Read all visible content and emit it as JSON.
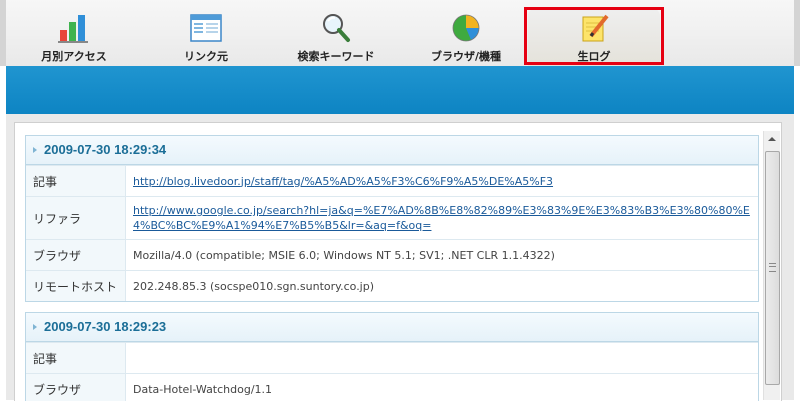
{
  "tabs": [
    {
      "label": "月別アクセス",
      "icon": "bar-chart-icon"
    },
    {
      "label": "リンク元",
      "icon": "window-list-icon"
    },
    {
      "label": "検索キーワード",
      "icon": "magnifier-icon"
    },
    {
      "label": "ブラウザ/機種",
      "icon": "pie-chart-icon"
    },
    {
      "label": "生ログ",
      "icon": "notepad-pencil-icon",
      "active": true
    }
  ],
  "colors": {
    "accent_blue": "#1490cc",
    "highlight_red": "#e60012",
    "heading_blue": "#1b6e97"
  },
  "entries": [
    {
      "timestamp": "2009-07-30 18:29:34",
      "rows": [
        {
          "label": "記事",
          "value": "http://blog.livedoor.jp/staff/tag/%A5%AD%A5%F3%C6%F9%A5%DE%A5%F3",
          "link": true
        },
        {
          "label": "リファラ",
          "value": "http://www.google.co.jp/search?hl=ja&q=%E7%AD%8B%E8%82%89%E3%83%9E%E3%83%B3%E3%80%80%E4%BC%BC%E9%A1%94%E7%B5%B5&lr=&aq=f&oq=",
          "link": true
        },
        {
          "label": "ブラウザ",
          "value": "Mozilla/4.0 (compatible; MSIE 6.0; Windows NT 5.1; SV1; .NET CLR 1.1.4322)",
          "link": false
        },
        {
          "label": "リモートホスト",
          "value": "202.248.85.3 (socspe010.sgn.suntory.co.jp)",
          "link": false
        }
      ]
    },
    {
      "timestamp": "2009-07-30 18:29:23",
      "rows": [
        {
          "label": "記事",
          "value": "",
          "link": false
        },
        {
          "label": "ブラウザ",
          "value": "Data-Hotel-Watchdog/1.1",
          "link": false
        }
      ]
    }
  ]
}
